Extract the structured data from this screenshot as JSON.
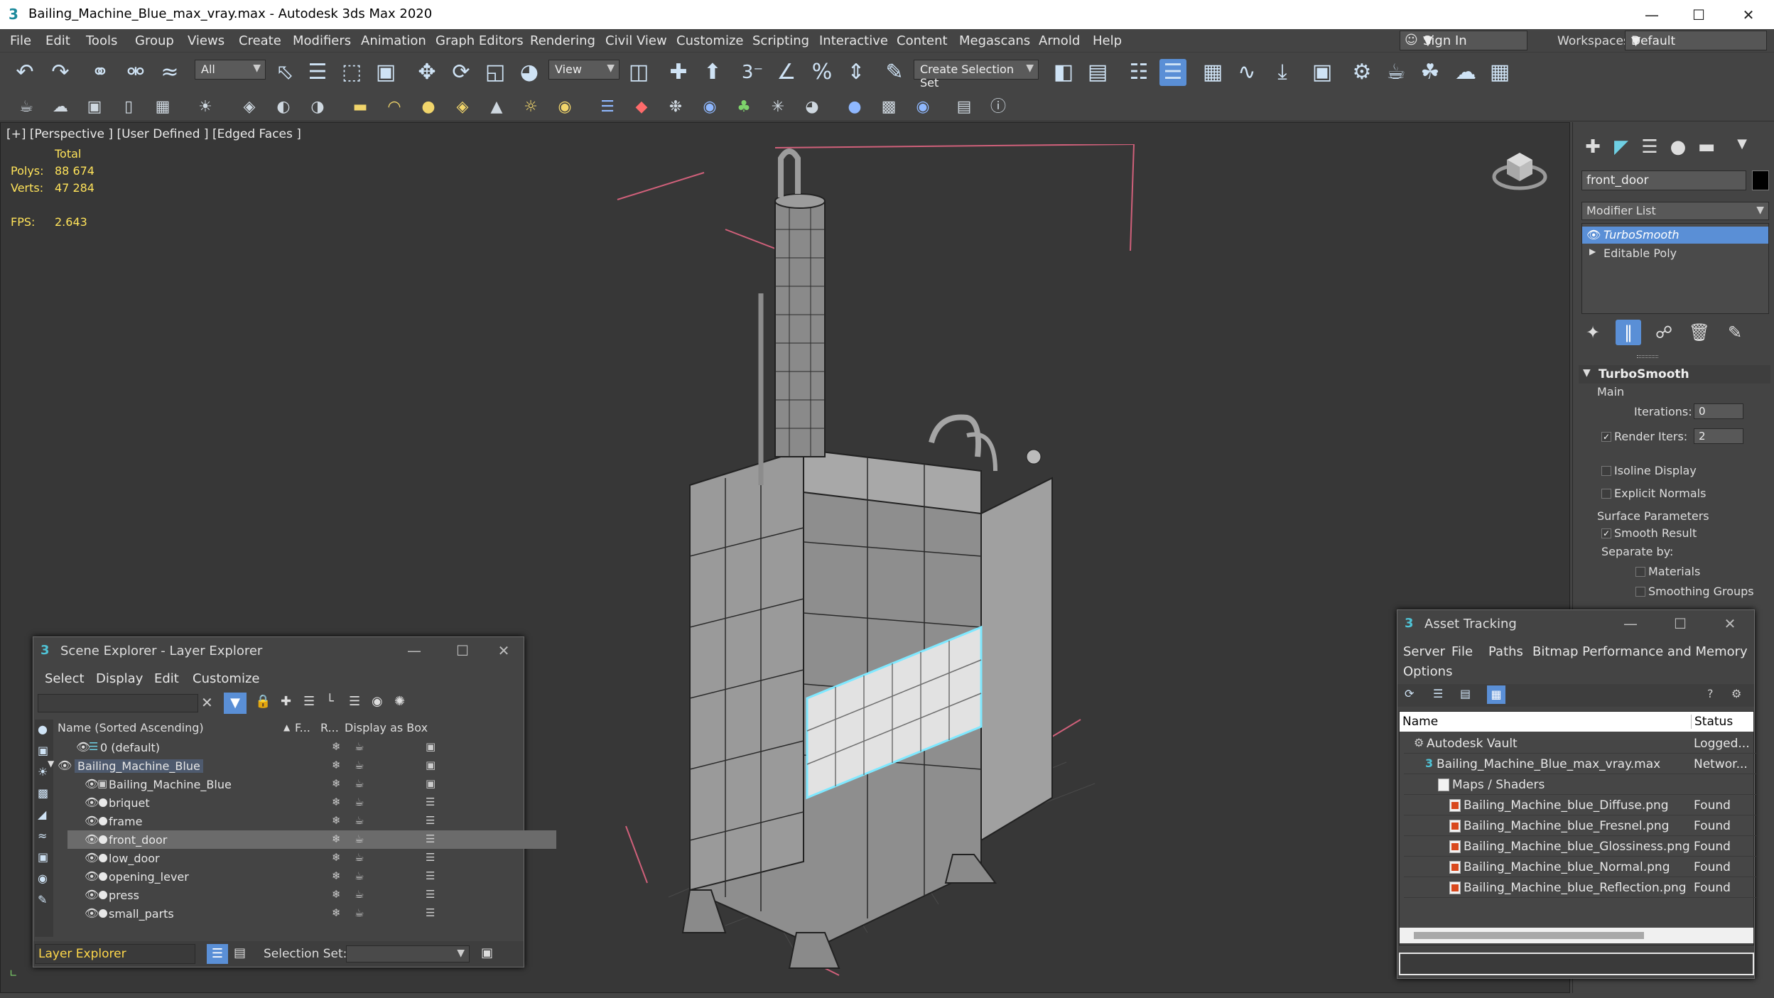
{
  "app": {
    "title": "Bailing_Machine_Blue_max_vray.max - Autodesk 3ds Max 2020",
    "icon": "3"
  },
  "menubar": {
    "items": [
      "File",
      "Edit",
      "Tools",
      "Group",
      "Views",
      "Create",
      "Modifiers",
      "Animation",
      "Graph Editors",
      "Rendering",
      "Civil View",
      "Customize",
      "Scripting",
      "Interactive",
      "Content",
      "Megascans",
      "Arnold",
      "Help"
    ],
    "sign_in": "Sign In",
    "workspaces_label": "Workspaces:",
    "workspace_value": "Default"
  },
  "toolbar": {
    "filter_value": "All",
    "refcoord_value": "View",
    "selection_set_value": "Create Selection Set"
  },
  "viewport": {
    "label": "[+] [Perspective ] [User Defined ] [Edged Faces ]",
    "stats": {
      "total_label": "Total",
      "polys_label": "Polys:",
      "polys_value": "88 674",
      "verts_label": "Verts:",
      "verts_value": "47 284",
      "fps_label": "FPS:",
      "fps_value": "2.643"
    }
  },
  "command_panel": {
    "object_name": "front_door",
    "modifier_list_label": "Modifier List",
    "stack": [
      "TurboSmooth",
      "Editable Poly"
    ],
    "rollout": {
      "title": "TurboSmooth",
      "main_label": "Main",
      "iterations_label": "Iterations:",
      "iterations_value": "0",
      "render_iters_label": "Render Iters:",
      "render_iters_value": "2",
      "isoline_label": "Isoline Display",
      "explicit_normals_label": "Explicit Normals",
      "surface_params_label": "Surface Parameters",
      "smooth_result_label": "Smooth Result",
      "separate_by_label": "Separate by:",
      "materials_label": "Materials",
      "smoothing_groups_label": "Smoothing Groups"
    }
  },
  "scene_explorer": {
    "title": "Scene Explorer - Layer Explorer",
    "menu": [
      "Select",
      "Display",
      "Edit",
      "Customize"
    ],
    "columns": {
      "name": "Name (Sorted Ascending)",
      "frozen": "F...",
      "render": "R...",
      "display_box": "Display as Box"
    },
    "rows": [
      {
        "name": "0 (default)",
        "level": 0,
        "type": "layer"
      },
      {
        "name": "Bailing_Machine_Blue",
        "level": 0,
        "type": "layer-expanded"
      },
      {
        "name": "Bailing_Machine_Blue",
        "level": 1,
        "type": "group"
      },
      {
        "name": "briquet",
        "level": 1,
        "type": "object"
      },
      {
        "name": "frame",
        "level": 1,
        "type": "object"
      },
      {
        "name": "front_door",
        "level": 1,
        "type": "object",
        "selected": true
      },
      {
        "name": "low_door",
        "level": 1,
        "type": "object"
      },
      {
        "name": "opening_lever",
        "level": 1,
        "type": "object"
      },
      {
        "name": "press",
        "level": 1,
        "type": "object"
      },
      {
        "name": "small_parts",
        "level": 1,
        "type": "object"
      }
    ],
    "footer_explorer": "Layer Explorer",
    "selection_set_label": "Selection Set:"
  },
  "asset_tracking": {
    "title": "Asset Tracking",
    "menu": [
      "Server",
      "File",
      "Paths",
      "Bitmap Performance and Memory",
      "Options"
    ],
    "columns": {
      "name": "Name",
      "status": "Status"
    },
    "rows": [
      {
        "name": "Autodesk Vault",
        "status": "Logged...",
        "indent": 0,
        "icon": "vault"
      },
      {
        "name": "Bailing_Machine_Blue_max_vray.max",
        "status": "Networ...",
        "indent": 1,
        "icon": "max"
      },
      {
        "name": "Maps / Shaders",
        "status": "",
        "indent": 2,
        "icon": "folder"
      },
      {
        "name": "Bailing_Machine_blue_Diffuse.png",
        "status": "Found",
        "indent": 3,
        "icon": "image"
      },
      {
        "name": "Bailing_Machine_blue_Fresnel.png",
        "status": "Found",
        "indent": 3,
        "icon": "image"
      },
      {
        "name": "Bailing_Machine_blue_Glossiness.png",
        "status": "Found",
        "indent": 3,
        "icon": "image"
      },
      {
        "name": "Bailing_Machine_blue_Normal.png",
        "status": "Found",
        "indent": 3,
        "icon": "image"
      },
      {
        "name": "Bailing_Machine_blue_Reflection.png",
        "status": "Found",
        "indent": 3,
        "icon": "image"
      }
    ]
  },
  "colors": {
    "selection_highlight": "#5a8fd6",
    "stat_yellow": "#ffe35a",
    "selected_object_outline": "#7fe8ff",
    "bounding_box": "#d0607a"
  }
}
